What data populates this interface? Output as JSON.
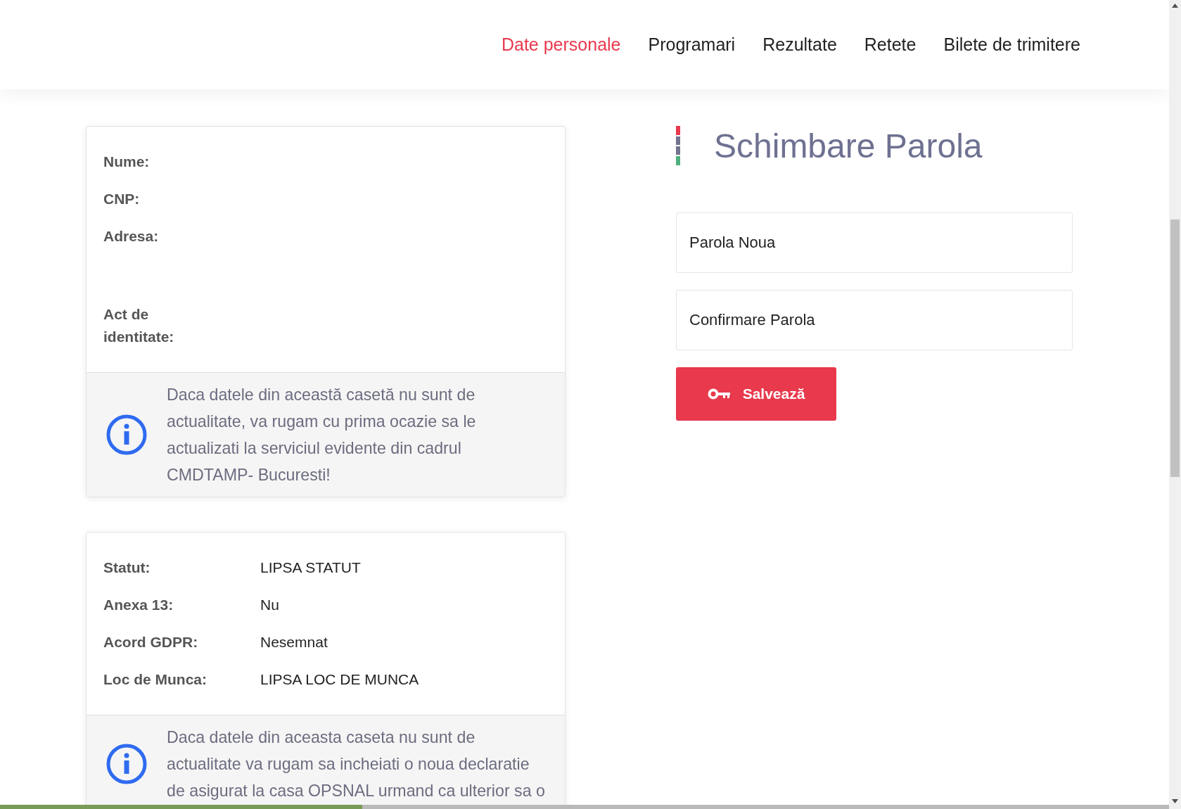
{
  "nav": {
    "items": [
      {
        "label": "Date personale",
        "selected": true
      },
      {
        "label": "Programari",
        "selected": false
      },
      {
        "label": "Rezultate",
        "selected": false
      },
      {
        "label": "Retete",
        "selected": false
      },
      {
        "label": "Bilete de trimitere",
        "selected": false
      }
    ]
  },
  "cards": [
    {
      "fields": [
        {
          "label": "Nume:",
          "kind": "short"
        },
        {
          "label": "CNP:",
          "kind": "short"
        },
        {
          "label": "Adresa:",
          "kind": "tall"
        },
        {
          "label": "Act de identitate:",
          "kind": "short"
        }
      ],
      "notice": "Daca datele din această casetă nu sunt de actualitate, va rugam cu prima ocazie sa le actualizati la serviciul evidente din cadrul CMDTAMP- Bucuresti!"
    },
    {
      "fields": [
        {
          "label": "Statut:",
          "value": "LIPSA STATUT",
          "kind": "short"
        },
        {
          "label": "Anexa 13:",
          "value": "Nu",
          "kind": "short"
        },
        {
          "label": "Acord GDPR:",
          "value": "Nesemnat",
          "kind": "short"
        },
        {
          "label": "Loc de Munca:",
          "value": "LIPSA LOC DE MUNCA",
          "kind": "short"
        }
      ],
      "notice": "Daca datele din aceasta caseta nu sunt de actualitate va rugam sa incheiati o noua declaratie de asigurat la casa OPSNAL urmand ca ulterior sa o"
    }
  ],
  "password_form": {
    "title": "Schimbare Parola",
    "fields": [
      {
        "placeholder": "Parola Noua"
      },
      {
        "placeholder": "Confirmare Parola"
      }
    ],
    "save_button": "Salvează"
  },
  "loading_bar": {
    "level": 0.31
  }
}
